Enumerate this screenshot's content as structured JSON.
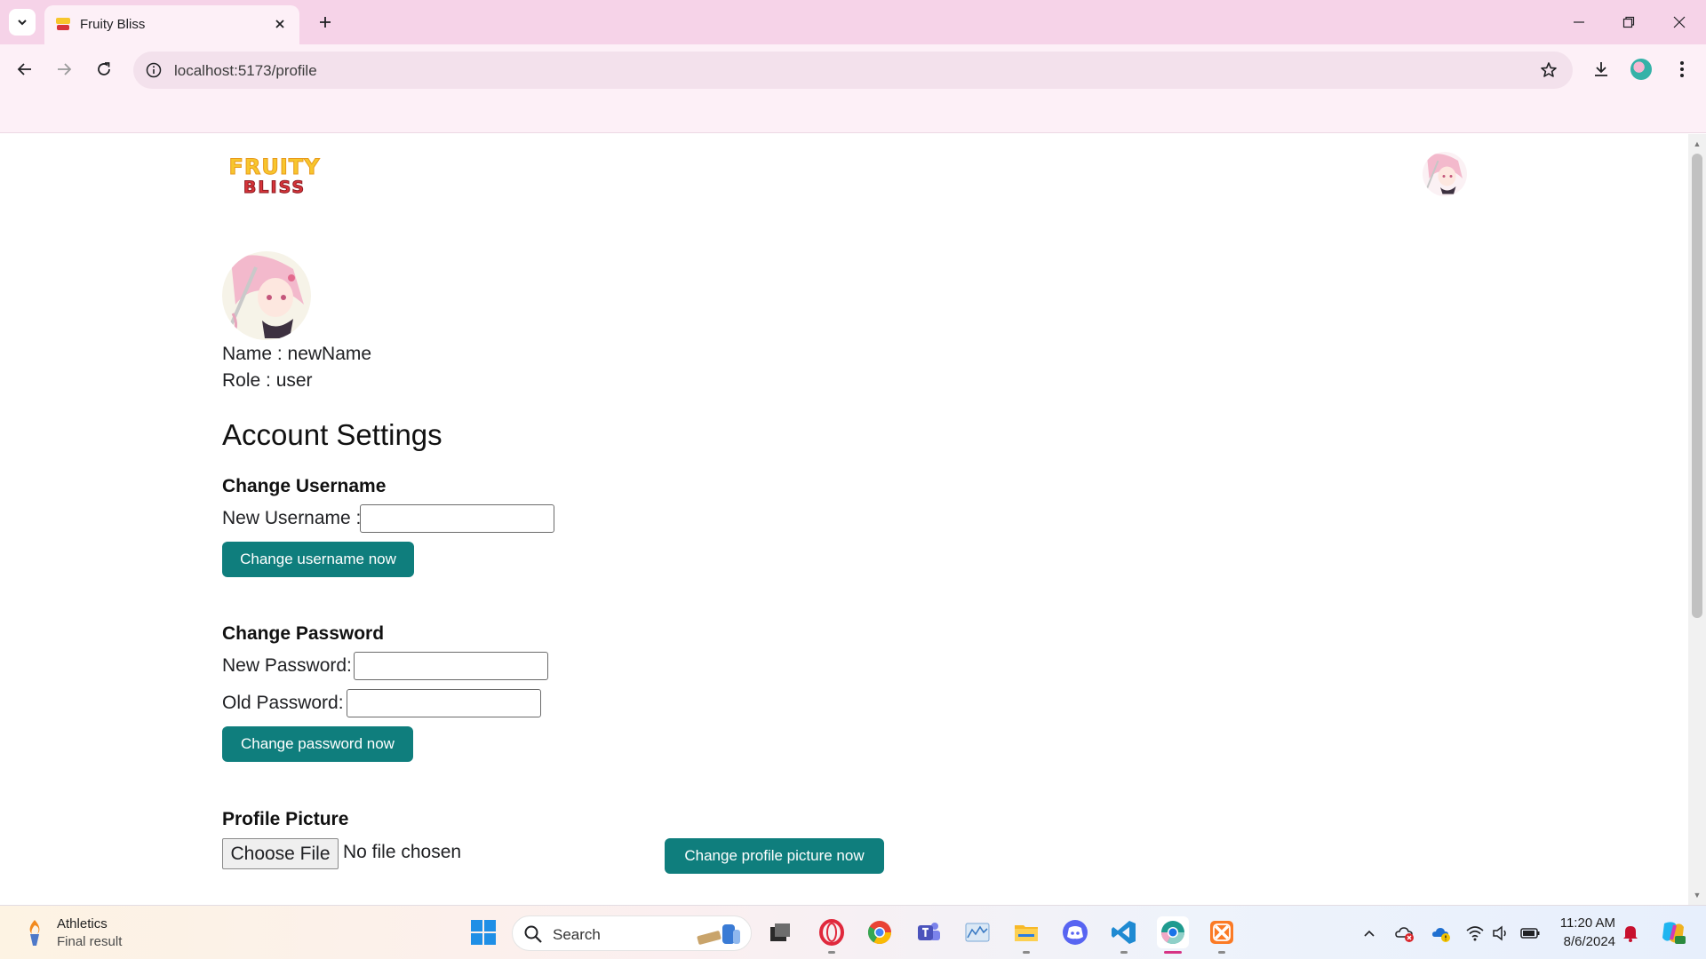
{
  "browser": {
    "tab_title": "Fruity Bliss",
    "url": "localhost:5173/profile"
  },
  "header": {
    "logo_line1": "FRUITY",
    "logo_line2": "BLISS"
  },
  "profile": {
    "name_line": "Name : newName",
    "role_line": "Role : user"
  },
  "settings": {
    "title": "Account Settings",
    "username": {
      "heading": "Change Username",
      "label": "New Username :",
      "value": "",
      "button": "Change username now"
    },
    "password": {
      "heading": "Change Password",
      "new_label": "New Password:",
      "new_value": "",
      "old_label": "Old Password:",
      "old_value": "",
      "button": "Change password now"
    },
    "picture": {
      "heading": "Profile Picture",
      "file_button": "Choose File",
      "file_status": "No file chosen",
      "button": "Change profile picture now"
    }
  },
  "taskbar": {
    "weather_title": "Athletics",
    "weather_sub": "Final result",
    "search_placeholder": "Search",
    "time": "11:20 AM",
    "date": "8/6/2024"
  },
  "colors": {
    "accent": "#0f7e7d",
    "tabbar": "#f6d3e8",
    "toolbar": "#fdf0f7"
  }
}
